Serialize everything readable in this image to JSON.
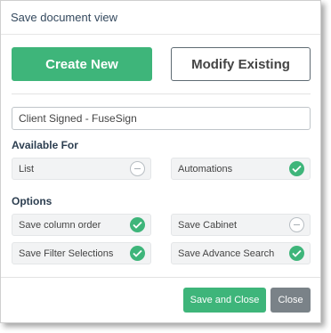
{
  "dialog": {
    "title": "Save document view"
  },
  "actions": {
    "create_new_label": "Create New",
    "modify_existing_label": "Modify Existing"
  },
  "view_name": {
    "value": "Client Signed - FuseSign"
  },
  "available_for": {
    "label": "Available For",
    "items": [
      {
        "label": "List",
        "checked": false
      },
      {
        "label": "Automations",
        "checked": true
      }
    ]
  },
  "options": {
    "label": "Options",
    "items": [
      {
        "label": "Save column order",
        "checked": true
      },
      {
        "label": "Save Cabinet",
        "checked": false
      },
      {
        "label": "Save Filter Selections",
        "checked": true
      },
      {
        "label": "Save Advance Search",
        "checked": true
      }
    ]
  },
  "footer": {
    "save_close_label": "Save and Close",
    "close_label": "Close"
  },
  "colors": {
    "accent": "#3eb57a",
    "secondary": "#7a8288"
  }
}
